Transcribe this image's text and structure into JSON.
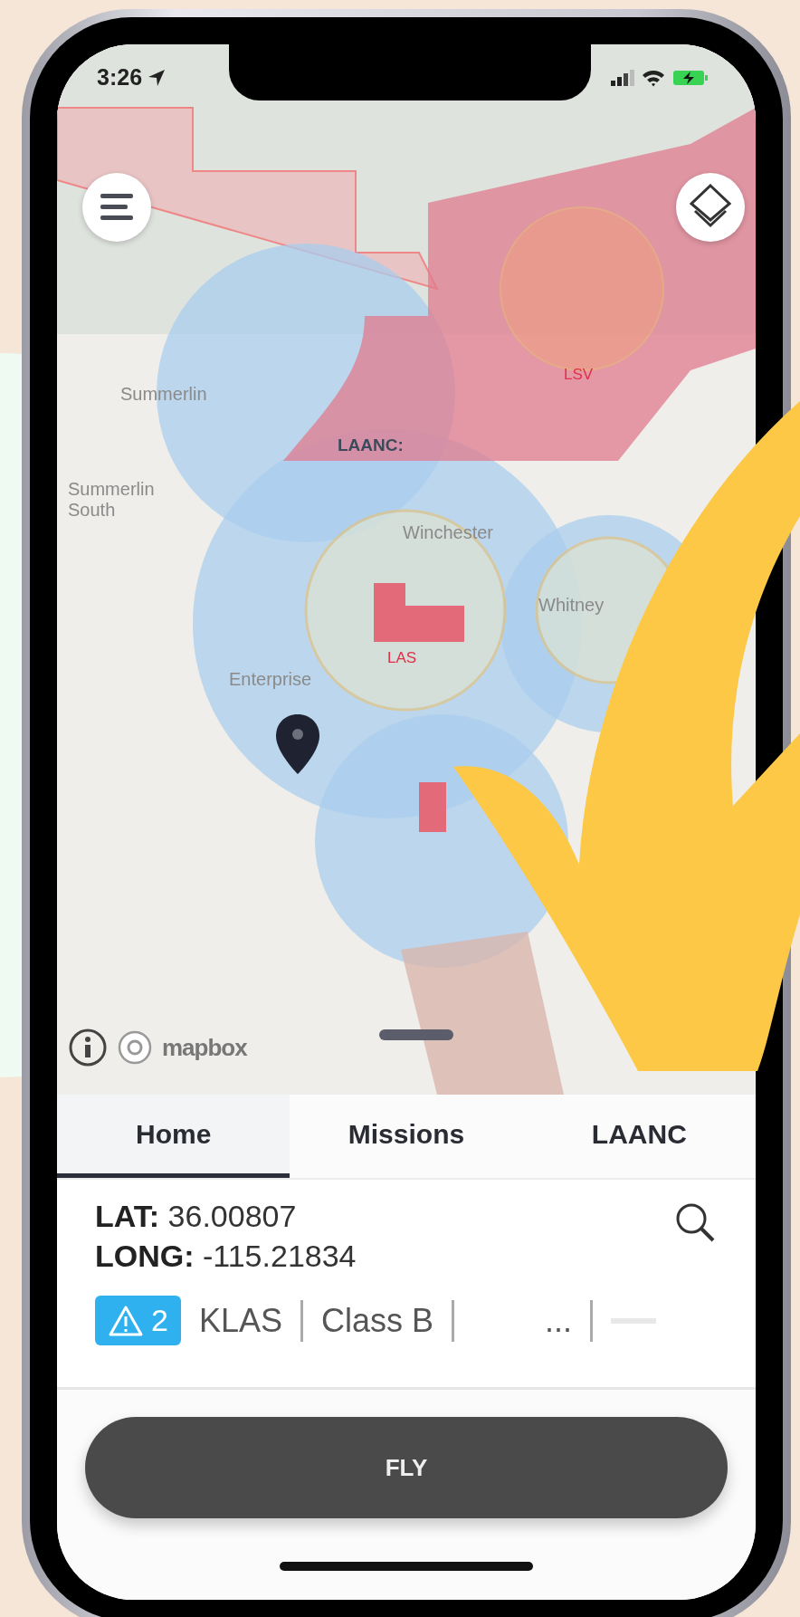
{
  "status_bar": {
    "time": "3:26"
  },
  "map": {
    "labels": [
      {
        "text": "Summerlin",
        "kind": "place"
      },
      {
        "text": "Summerlin South",
        "kind": "place"
      },
      {
        "text": "LAANC:",
        "kind": "zone"
      },
      {
        "text": "Winchester",
        "kind": "place"
      },
      {
        "text": "Whitney",
        "kind": "place"
      },
      {
        "text": "LSV",
        "kind": "airport"
      },
      {
        "text": "LAS",
        "kind": "airport"
      },
      {
        "text": "Enterprise",
        "kind": "place"
      }
    ],
    "attribution": "mapbox"
  },
  "tabs": [
    {
      "label": "Home",
      "selected": true
    },
    {
      "label": "Missions",
      "selected": false
    },
    {
      "label": "LAANC",
      "selected": false
    }
  ],
  "location": {
    "lat": "**LAT:** 36.00807",
    "long": "**LONG:** -115.21834"
  },
  "alert_badge": {
    "count": "2"
  },
  "airspace": [
    "KLAS",
    "Class B",
    "..."
  ],
  "fly_button": "FLY"
}
